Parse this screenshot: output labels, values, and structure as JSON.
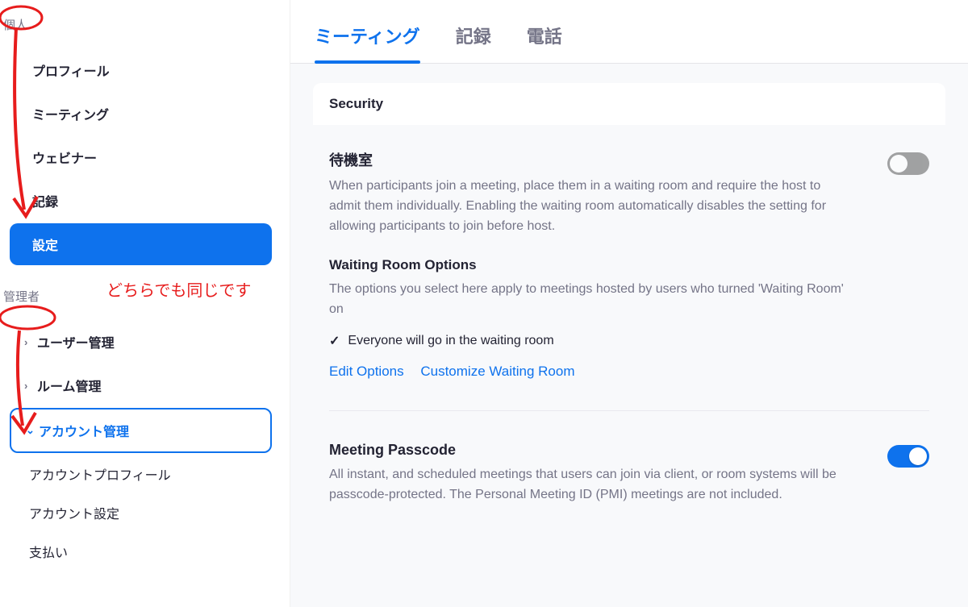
{
  "sidebar": {
    "personal_label": "個人",
    "items": [
      {
        "label": "プロフィール"
      },
      {
        "label": "ミーティング"
      },
      {
        "label": "ウェビナー"
      },
      {
        "label": "記録"
      },
      {
        "label": "設定",
        "active": true
      }
    ],
    "admin_label": "管理者",
    "admin_items": [
      {
        "label": "ユーザー管理"
      },
      {
        "label": "ルーム管理"
      },
      {
        "label": "アカウント管理",
        "expanded": true
      }
    ],
    "account_sub": [
      {
        "label": "アカウントプロフィール"
      },
      {
        "label": "アカウント設定"
      },
      {
        "label": "支払い"
      }
    ]
  },
  "tabs": [
    {
      "label": "ミーティング",
      "active": true
    },
    {
      "label": "記録"
    },
    {
      "label": "電話"
    }
  ],
  "security_header": "Security",
  "waiting_room": {
    "title": "待機室",
    "desc": "When participants join a meeting, place them in a waiting room and require the host to admit them individually. Enabling the waiting room automatically disables the setting for allowing participants to join before host.",
    "enabled": false
  },
  "waiting_options": {
    "title": "Waiting Room Options",
    "desc": "The options you select here apply to meetings hosted by users who turned 'Waiting Room' on",
    "option": "Everyone will go in the waiting room",
    "edit_link": "Edit Options",
    "customize_link": "Customize Waiting Room"
  },
  "passcode": {
    "title": "Meeting Passcode",
    "desc": "All instant, and scheduled meetings that users can join via client, or room systems will be passcode-protected. The Personal Meeting ID (PMI) meetings are not included.",
    "enabled": true
  },
  "annotation_text": "どちらでも同じです"
}
